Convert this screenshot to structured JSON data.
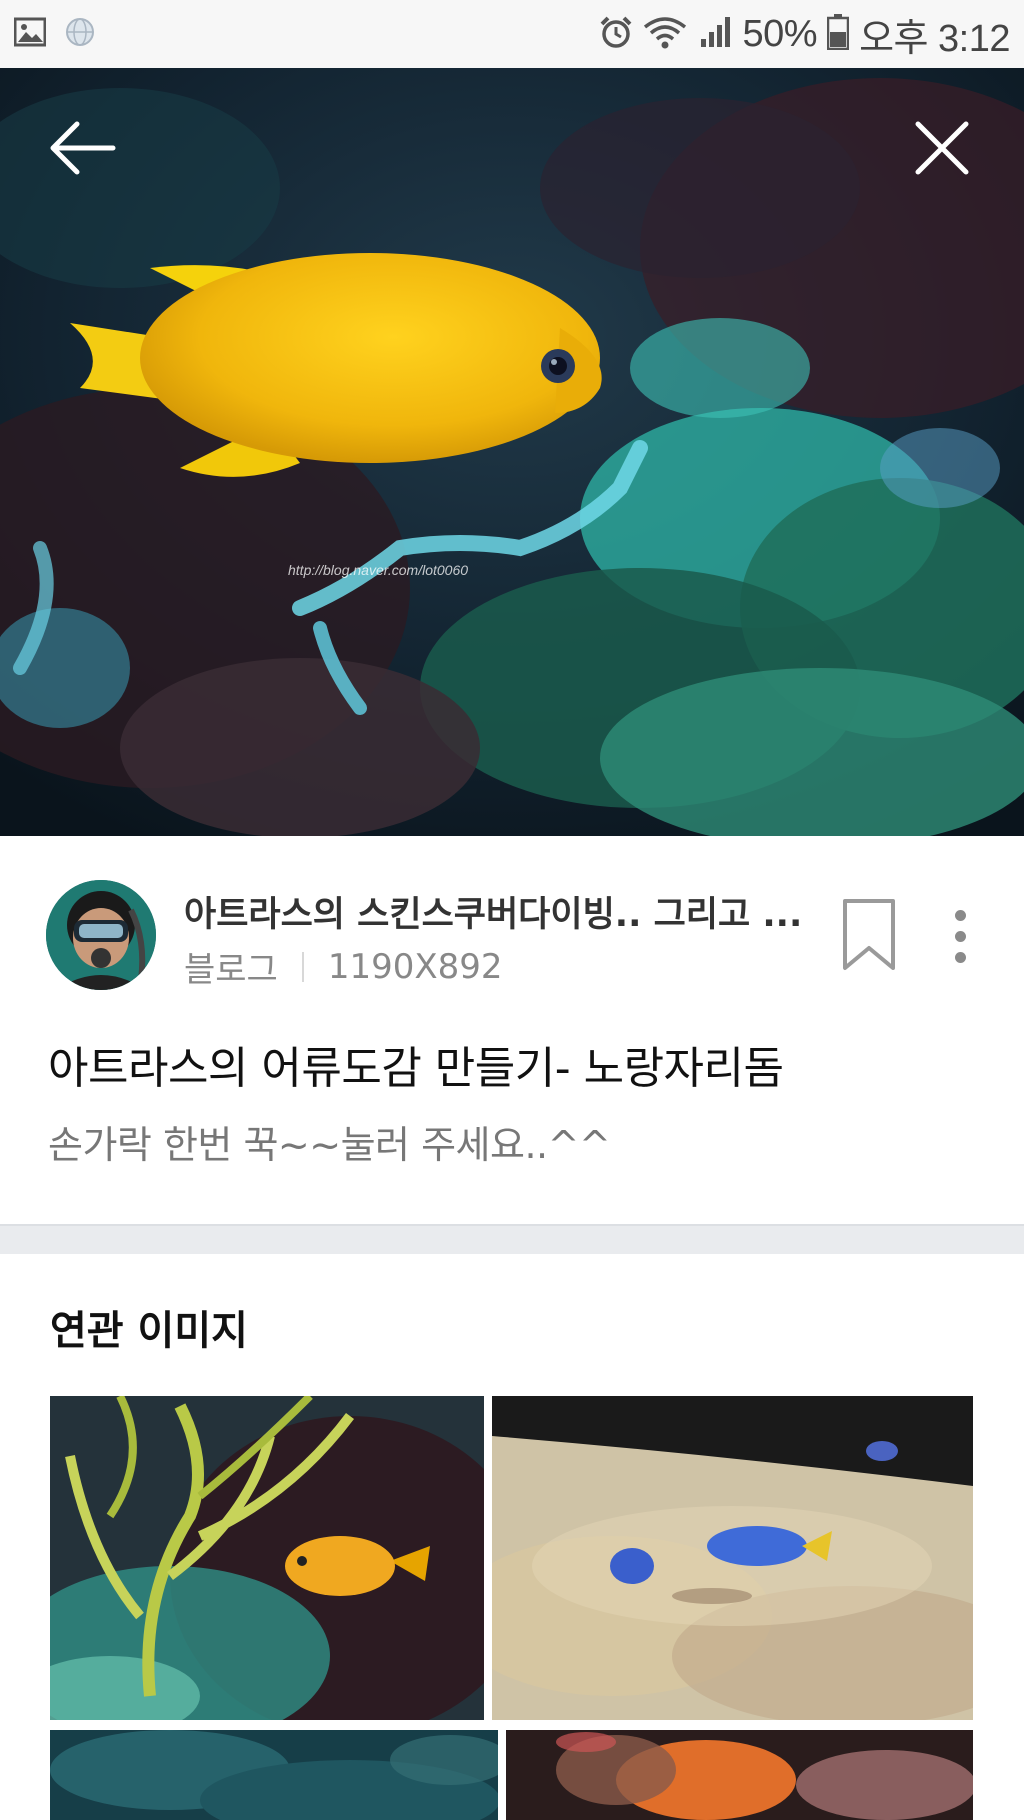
{
  "status_bar": {
    "battery": "50%",
    "time": "오후 3:12",
    "icons": [
      "gallery-icon",
      "globe-icon",
      "alarm-icon",
      "wifi-icon",
      "signal-icon",
      "battery-icon"
    ]
  },
  "hero": {
    "watermark": "http://blog.naver.com/lot0060",
    "back_icon": "arrow-left-icon",
    "close_icon": "close-icon"
  },
  "info": {
    "source_title": "아트라스의 스킨스쿠버다이빙.. 그리고 ...",
    "source_type": "블로그",
    "dimensions": "1190X892",
    "post_title": "아트라스의 어류도감 만들기- 노랑자리돔",
    "post_desc": "손가락 한번 꾹~~눌러 주세요..^^"
  },
  "related": {
    "heading": "연관 이미지"
  },
  "colors": {
    "accent_fish": "#f0c010",
    "text_dark": "#111111",
    "text_muted": "#888888",
    "divider": "#e9ebee"
  }
}
